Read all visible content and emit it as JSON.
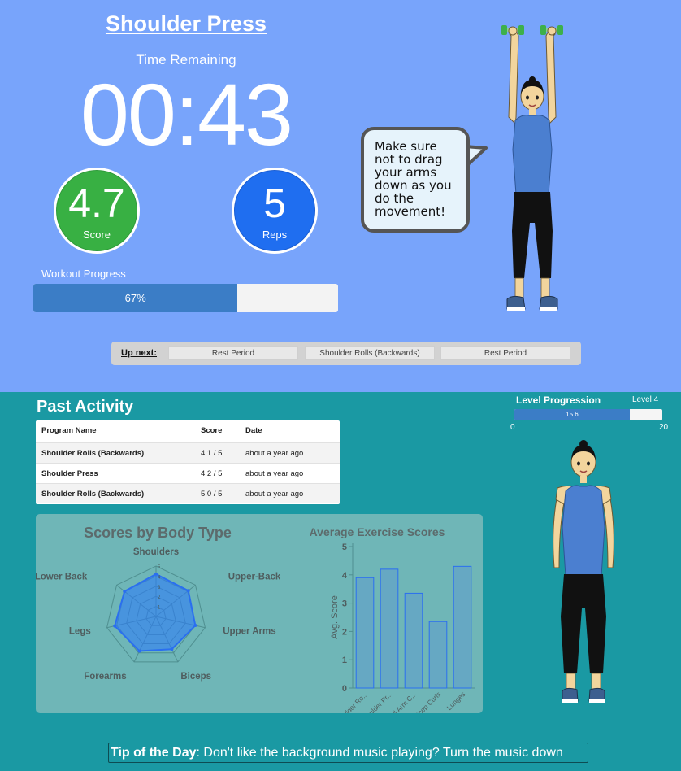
{
  "exercise": {
    "title": "Shoulder Press",
    "time_label": "Time Remaining",
    "time": "00:43"
  },
  "stats": {
    "score": "4.7",
    "score_label": "Score",
    "reps": "5",
    "reps_label": "Reps"
  },
  "workout_progress": {
    "label": "Workout Progress",
    "text": "67%",
    "fraction": 0.67
  },
  "bubble_lines": [
    "Make sure",
    "not to drag",
    "your arms",
    "down as you",
    "do the",
    "movement!"
  ],
  "up_next": {
    "label": "Up next:",
    "items": [
      "Rest Period",
      "Shoulder Rolls (Backwards)",
      "Rest Period"
    ]
  },
  "past_activity": {
    "title": "Past Activity",
    "headers": [
      "Program Name",
      "Score",
      "Date"
    ],
    "rows": [
      [
        "Shoulder Rolls (Backwards)",
        "4.1 / 5",
        "about a year ago"
      ],
      [
        "Shoulder Press",
        "4.2 / 5",
        "about a year ago"
      ],
      [
        "Shoulder Rolls (Backwards)",
        "5.0 / 5",
        "about a year ago"
      ]
    ]
  },
  "level": {
    "label": "Level Progression",
    "level_text": "Level 4",
    "value_text": "15.6",
    "min": "0",
    "max": "20",
    "fraction": 0.78
  },
  "tip": {
    "label": "Tip of the Day",
    "text": ": Don't like the background music playing? Turn the music down"
  },
  "colors": {
    "top_bg": "#78a4fb",
    "bottom_bg": "#1a99a3",
    "score_green": "#38b043",
    "reps_blue": "#1f6ef0",
    "progress_blue": "#3b7dc6",
    "shirt": "#4b7fd0"
  },
  "chart_data": [
    {
      "type": "radar",
      "title": "Scores by Body Type",
      "axes": [
        "Shoulders",
        "Upper-Back",
        "Upper Arms",
        "Biceps",
        "Forearms",
        "Legs",
        "Lower Back"
      ],
      "values": [
        4.2,
        4.1,
        4.0,
        3.6,
        3.8,
        4.2,
        4.0
      ],
      "max": 5,
      "ticks": [
        "1",
        "2",
        "3",
        "4",
        "5"
      ]
    },
    {
      "type": "bar",
      "title": "Average Exercise Scores",
      "ylabel": "Avg. Score",
      "categories": [
        "Shoulder Ro...",
        "Shoulder Pr...",
        "Small Arm C...",
        "Bicep Curls",
        "Lunges"
      ],
      "values": [
        3.9,
        4.2,
        3.35,
        2.35,
        4.3
      ],
      "ylim": [
        0,
        5
      ],
      "yticks": [
        "0",
        "1",
        "2",
        "3",
        "4",
        "5"
      ]
    }
  ]
}
